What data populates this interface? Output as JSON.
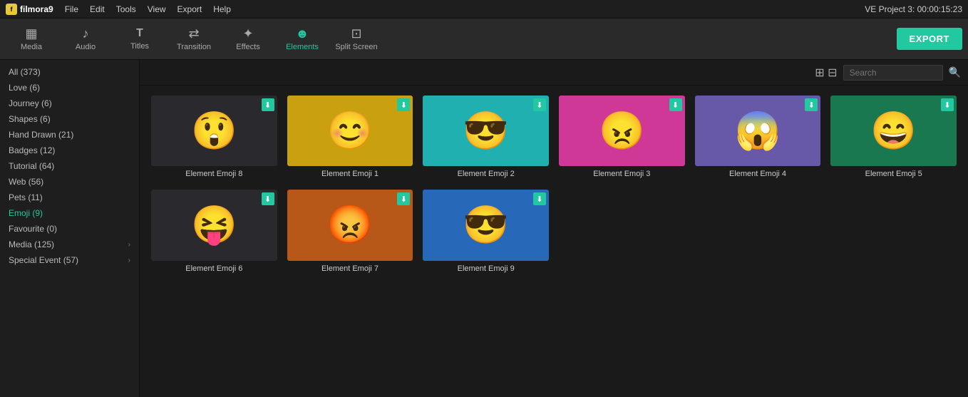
{
  "app": {
    "name": "filmora9",
    "title": "VE Project 3: 00:00:15:23"
  },
  "menu": {
    "items": [
      "File",
      "Edit",
      "Tools",
      "View",
      "Export",
      "Help"
    ]
  },
  "toolbar": {
    "items": [
      {
        "id": "media",
        "label": "Media",
        "icon": "▦",
        "active": false
      },
      {
        "id": "audio",
        "label": "Audio",
        "icon": "♪",
        "active": false
      },
      {
        "id": "titles",
        "label": "Titles",
        "icon": "T",
        "active": false
      },
      {
        "id": "transition",
        "label": "Transition",
        "icon": "⇄",
        "active": false
      },
      {
        "id": "effects",
        "label": "Effects",
        "icon": "✦",
        "active": false
      },
      {
        "id": "elements",
        "label": "Elements",
        "icon": "☻",
        "active": true
      },
      {
        "id": "splitscreen",
        "label": "Split Screen",
        "icon": "⊡",
        "active": false
      }
    ],
    "export_label": "EXPORT"
  },
  "sidebar": {
    "items": [
      {
        "id": "all",
        "label": "All (373)",
        "active": false,
        "has_chevron": false
      },
      {
        "id": "love",
        "label": "Love (6)",
        "active": false,
        "has_chevron": false
      },
      {
        "id": "journey",
        "label": "Journey (6)",
        "active": false,
        "has_chevron": false
      },
      {
        "id": "shapes",
        "label": "Shapes (6)",
        "active": false,
        "has_chevron": false
      },
      {
        "id": "handdrawn",
        "label": "Hand Drawn (21)",
        "active": false,
        "has_chevron": false
      },
      {
        "id": "badges",
        "label": "Badges (12)",
        "active": false,
        "has_chevron": false
      },
      {
        "id": "tutorial",
        "label": "Tutorial (64)",
        "active": false,
        "has_chevron": false
      },
      {
        "id": "web",
        "label": "Web (56)",
        "active": false,
        "has_chevron": false
      },
      {
        "id": "pets",
        "label": "Pets (11)",
        "active": false,
        "has_chevron": false
      },
      {
        "id": "emoji",
        "label": "Emoji (9)",
        "active": true,
        "has_chevron": false
      },
      {
        "id": "favourite",
        "label": "Favourite (0)",
        "active": false,
        "has_chevron": false
      },
      {
        "id": "media",
        "label": "Media (125)",
        "active": false,
        "has_chevron": true
      },
      {
        "id": "specialevent",
        "label": "Special Event (57)",
        "active": false,
        "has_chevron": true
      }
    ]
  },
  "search": {
    "placeholder": "Search",
    "value": ""
  },
  "grid": {
    "items": [
      {
        "id": "emoji8",
        "label": "Element Emoji 8",
        "emoji": "😲",
        "bg": "bg-dark",
        "has_download": true
      },
      {
        "id": "emoji1",
        "label": "Element Emoji 1",
        "emoji": "😊",
        "bg": "bg-yellow",
        "has_download": true
      },
      {
        "id": "emoji2",
        "label": "Element Emoji 2",
        "emoji": "😎",
        "bg": "bg-teal",
        "has_download": true
      },
      {
        "id": "emoji3",
        "label": "Element Emoji 3",
        "emoji": "😠",
        "bg": "bg-pink",
        "has_download": true
      },
      {
        "id": "emoji4",
        "label": "Element Emoji 4",
        "emoji": "😱",
        "bg": "bg-purple",
        "has_download": true
      },
      {
        "id": "emoji5",
        "label": "Element Emoji 5",
        "emoji": "😄",
        "bg": "bg-green-dark",
        "has_download": true
      },
      {
        "id": "emoji6",
        "label": "Element Emoji 6",
        "emoji": "😝",
        "bg": "bg-dark",
        "has_download": true
      },
      {
        "id": "emoji7",
        "label": "Element Emoji 7",
        "emoji": "😡",
        "bg": "bg-orange2",
        "has_download": true
      },
      {
        "id": "emoji9",
        "label": "Element Emoji 9",
        "emoji": "😎",
        "bg": "bg-blue",
        "has_download": true
      }
    ]
  },
  "icons": {
    "download": "⬇",
    "grid_view": "⊞",
    "search": "🔍",
    "chevron_right": "›"
  }
}
